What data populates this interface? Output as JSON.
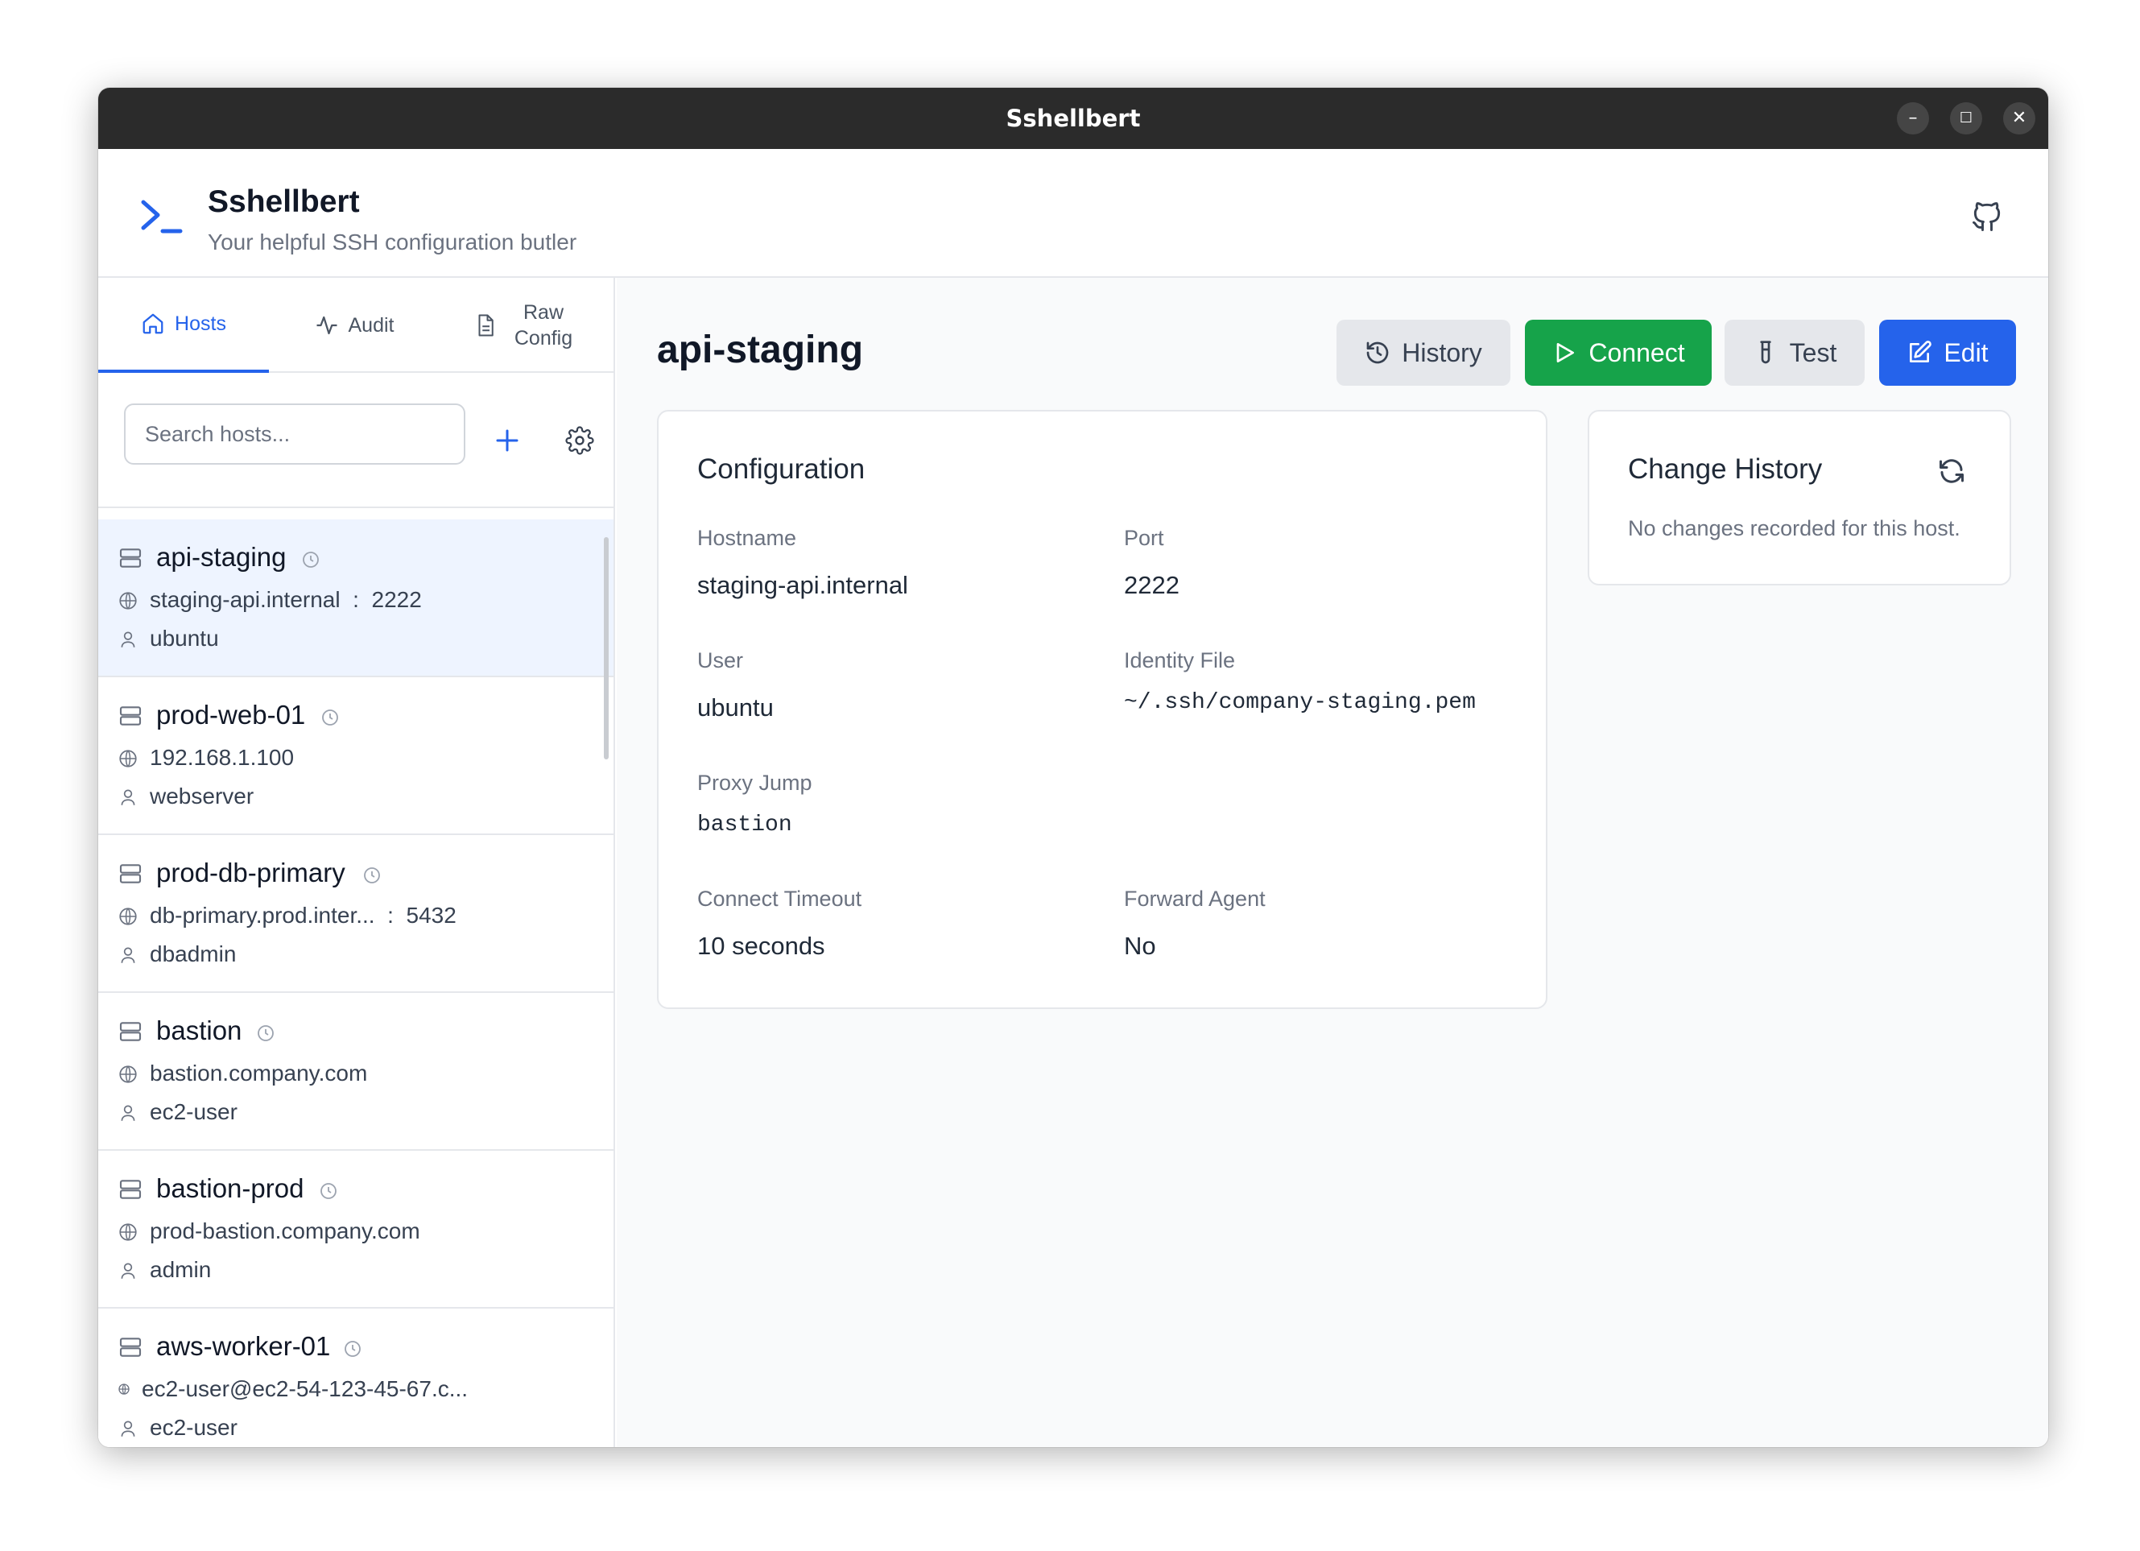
{
  "window": {
    "title": "Sshellbert"
  },
  "app": {
    "name": "Sshellbert",
    "tagline": "Your helpful SSH configuration butler"
  },
  "sidebar": {
    "tabs": [
      {
        "label": "Hosts",
        "icon": "home-icon",
        "active": true
      },
      {
        "label": "Audit",
        "icon": "activity-icon",
        "active": false
      },
      {
        "label": "Raw Config",
        "icon": "file-icon",
        "active": false
      }
    ],
    "search": {
      "placeholder": "Search hosts...",
      "value": ""
    },
    "hosts": [
      {
        "name": "api-staging",
        "hostname": "staging-api.internal",
        "port": "2222",
        "user": "ubuntu",
        "selected": true
      },
      {
        "name": "prod-web-01",
        "hostname": "192.168.1.100",
        "port": "",
        "user": "webserver",
        "selected": false
      },
      {
        "name": "prod-db-primary",
        "hostname": "db-primary.prod.inter...",
        "port": "5432",
        "user": "dbadmin",
        "selected": false
      },
      {
        "name": "bastion",
        "hostname": "bastion.company.com",
        "port": "",
        "user": "ec2-user",
        "selected": false
      },
      {
        "name": "bastion-prod",
        "hostname": "prod-bastion.company.com",
        "port": "",
        "user": "admin",
        "selected": false
      },
      {
        "name": "aws-worker-01",
        "hostname": "ec2-user@ec2-54-123-45-67.c...",
        "port": "",
        "user": "ec2-user",
        "selected": false
      }
    ]
  },
  "main": {
    "host_title": "api-staging",
    "actions": {
      "history": "History",
      "connect": "Connect",
      "test": "Test",
      "edit": "Edit"
    },
    "config": {
      "title": "Configuration",
      "hostname_label": "Hostname",
      "hostname": "staging-api.internal",
      "port_label": "Port",
      "port": "2222",
      "user_label": "User",
      "user": "ubuntu",
      "identity_label": "Identity File",
      "identity": "~/.ssh/company-staging.pem",
      "proxy_label": "Proxy Jump",
      "proxy": "bastion",
      "timeout_label": "Connect Timeout",
      "timeout": "10 seconds",
      "agent_label": "Forward Agent",
      "agent": "No"
    },
    "change_history": {
      "title": "Change History",
      "empty": "No changes recorded for this host."
    }
  },
  "colors": {
    "primary": "#2563eb",
    "success": "#16a34a",
    "titlebar": "#2b2b2b",
    "selected_bg": "#eef4ff"
  }
}
